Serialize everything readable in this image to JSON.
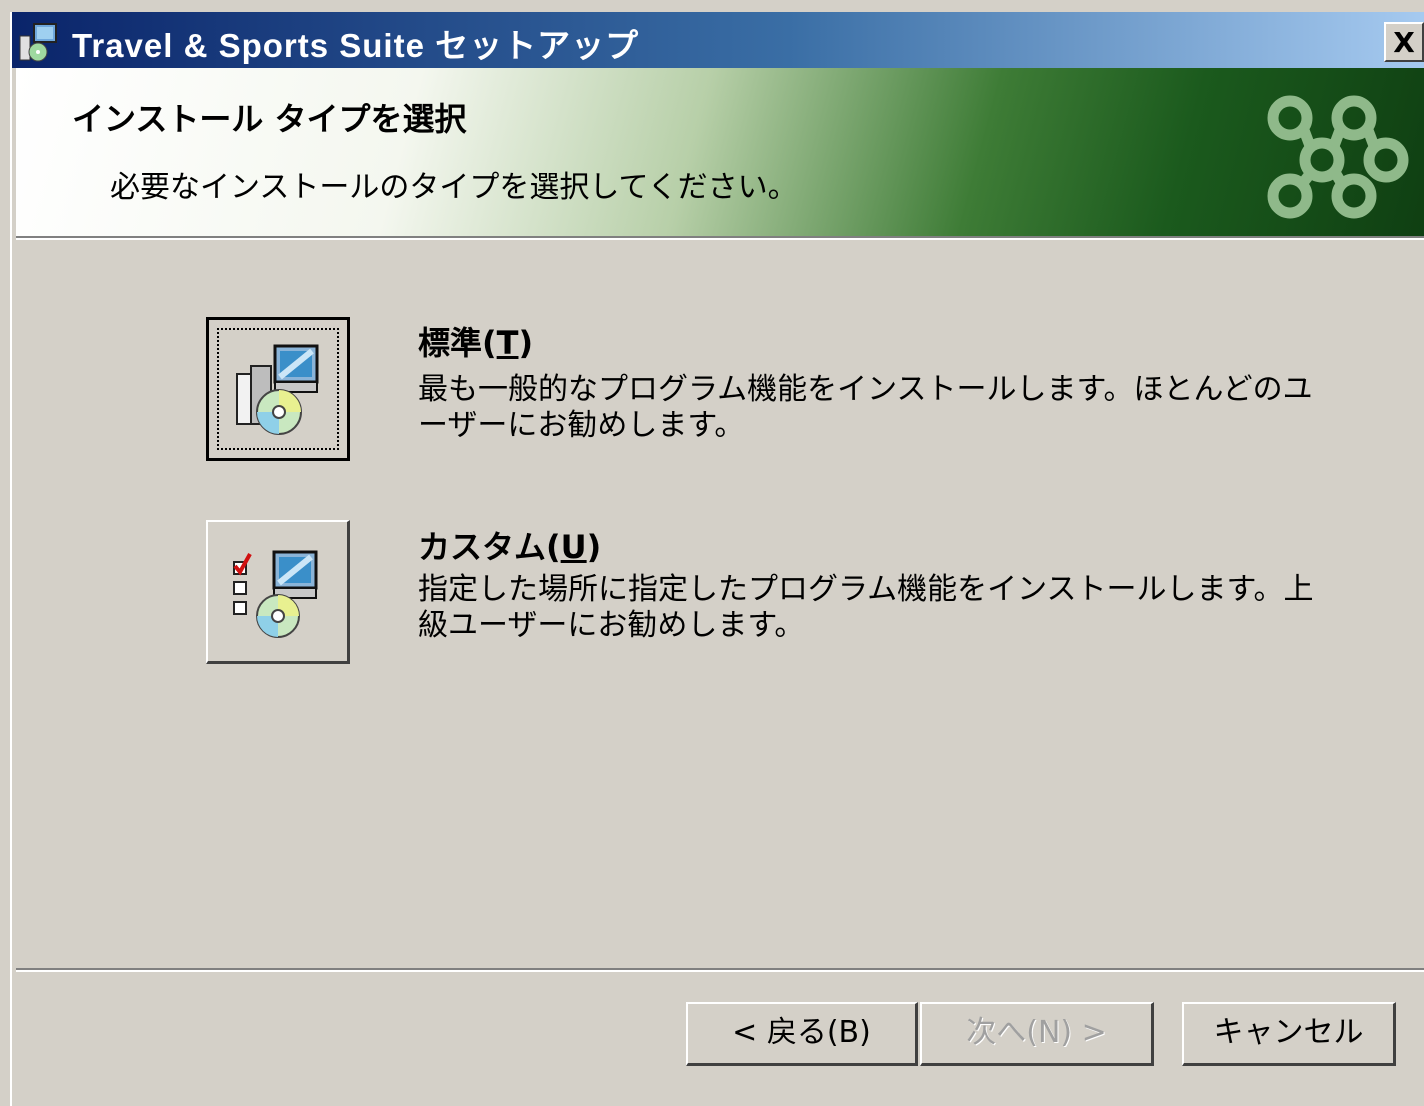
{
  "window": {
    "title": "Travel & Sports Suite セットアップ",
    "close_label": "X"
  },
  "banner": {
    "title": "インストール タイプを選択",
    "subtitle": "必要なインストールのタイプを選択してください。"
  },
  "options": [
    {
      "title": "標準(",
      "accel": "T",
      "title_end": ")",
      "description": "最も一般的なプログラム機能をインストールします。ほとんどのユーザーにお勧めします。"
    },
    {
      "title": "カスタム(",
      "accel": "U",
      "title_end": ")",
      "description": "指定した場所に指定したプログラム機能をインストールします。上級ユーザーにお勧めします。"
    }
  ],
  "buttons": {
    "back": "< 戻る(B)",
    "next": "次へ(N) >",
    "cancel": "キャンセル"
  },
  "colors": {
    "titlebar_start": "#0a246a",
    "titlebar_end": "#a6caf0",
    "face": "#d4d0c8",
    "banner_green": "#1b5a1d"
  }
}
